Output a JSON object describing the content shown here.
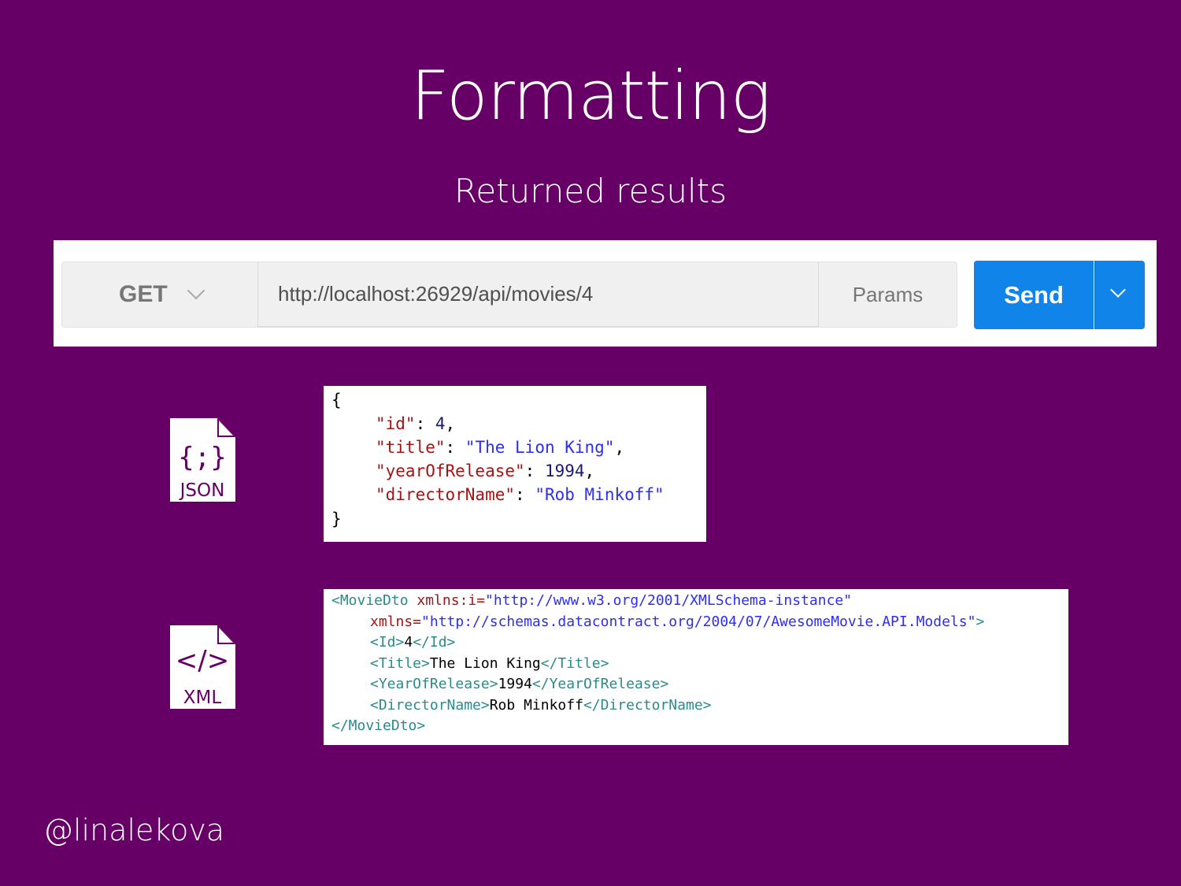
{
  "slide": {
    "title": "Formatting",
    "subtitle": "Returned results",
    "handle": "@linalekova"
  },
  "request": {
    "method": "GET",
    "url": "http://localhost:26929/api/movies/4",
    "params_label": "Params",
    "send_label": "Send"
  },
  "json_icon": {
    "label": "JSON",
    "glyph": "{;}"
  },
  "xml_icon": {
    "label": "XML",
    "glyph": "</>"
  },
  "json_response": {
    "open": "{",
    "close": "}",
    "fields": [
      {
        "key": "\"id\"",
        "sep": ": ",
        "value": "4",
        "trail": ","
      },
      {
        "key": "\"title\"",
        "sep": ": ",
        "value": "\"The Lion King\"",
        "trail": ","
      },
      {
        "key": "\"yearOfRelease\"",
        "sep": ": ",
        "value": "1994",
        "trail": ","
      },
      {
        "key": "\"directorName\"",
        "sep": ": ",
        "value": "\"Rob Minkoff\"",
        "trail": ""
      }
    ]
  },
  "xml_response": {
    "root_open": "<MovieDto",
    "ns_i_attr": " xmlns:i=",
    "ns_i_value": "\"http://www.w3.org/2001/XMLSchema-instance\"",
    "ns_attr": "xmlns=",
    "ns_value": "\"http://schemas.datacontract.org/2004/07/AwesomeMovie.API.Models\"",
    "ns_close": ">",
    "elements": [
      {
        "open": "<Id>",
        "value": "4",
        "close": "</Id>"
      },
      {
        "open": "<Title>",
        "value": "The Lion King",
        "close": "</Title>"
      },
      {
        "open": "<YearOfRelease>",
        "value": "1994",
        "close": "</YearOfRelease>"
      },
      {
        "open": "<DirectorName>",
        "value": "Rob Minkoff",
        "close": "</DirectorName>"
      }
    ],
    "root_close": "</MovieDto>"
  },
  "colors": {
    "background": "#660066",
    "send": "#1184ea",
    "json_key": "#a31515",
    "json_string": "#2d2df5",
    "xml_tag": "#2b8a8a"
  }
}
